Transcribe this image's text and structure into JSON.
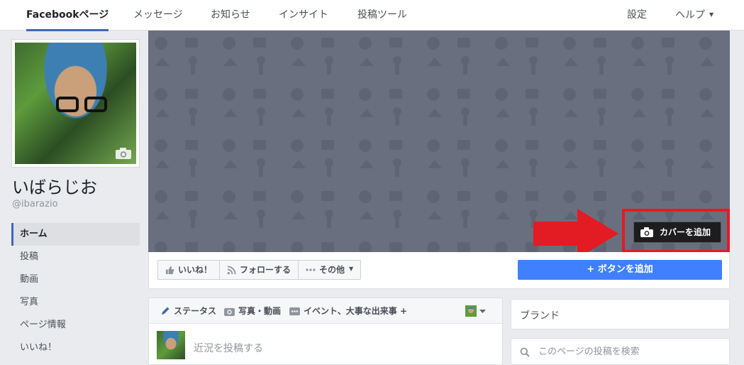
{
  "topnav": {
    "tabs": [
      {
        "label": "Facebookページ"
      },
      {
        "label": "メッセージ"
      },
      {
        "label": "お知らせ"
      },
      {
        "label": "インサイト"
      },
      {
        "label": "投稿ツール"
      }
    ],
    "settings_label": "設定",
    "help_label": "ヘルプ"
  },
  "profile": {
    "name": "いばらじお",
    "handle": "@ibarazio"
  },
  "leftnav": {
    "items": [
      {
        "label": "ホーム"
      },
      {
        "label": "投稿"
      },
      {
        "label": "動画"
      },
      {
        "label": "写真"
      },
      {
        "label": "ページ情報"
      },
      {
        "label": "いいね！"
      }
    ]
  },
  "cover": {
    "add_cover_label": "カバーを追加"
  },
  "actionbar": {
    "like_label": "いいね！",
    "follow_label": "フォローする",
    "more_label": "その他",
    "add_button_label": "+ ボタンを追加"
  },
  "composer": {
    "tab_status": "ステータス",
    "tab_photo_video": "写真・動画",
    "tab_event": "イベント、大事な出来事 +",
    "placeholder": "近況を投稿する"
  },
  "sidebar": {
    "brand_label": "ブランド",
    "search_placeholder": "このページの投稿を検索"
  },
  "colors": {
    "accent": "#4267b2",
    "button_blue": "#4080ff",
    "highlight_red": "#e31b23",
    "cover_gray": "#6a6f7f"
  },
  "icons": [
    "camera-icon",
    "thumbs-up-icon",
    "rss-icon",
    "more-dots-icon",
    "pencil-icon",
    "photo-icon",
    "event-icon",
    "search-icon",
    "chevron-down-icon",
    "arrow-right-icon"
  ]
}
